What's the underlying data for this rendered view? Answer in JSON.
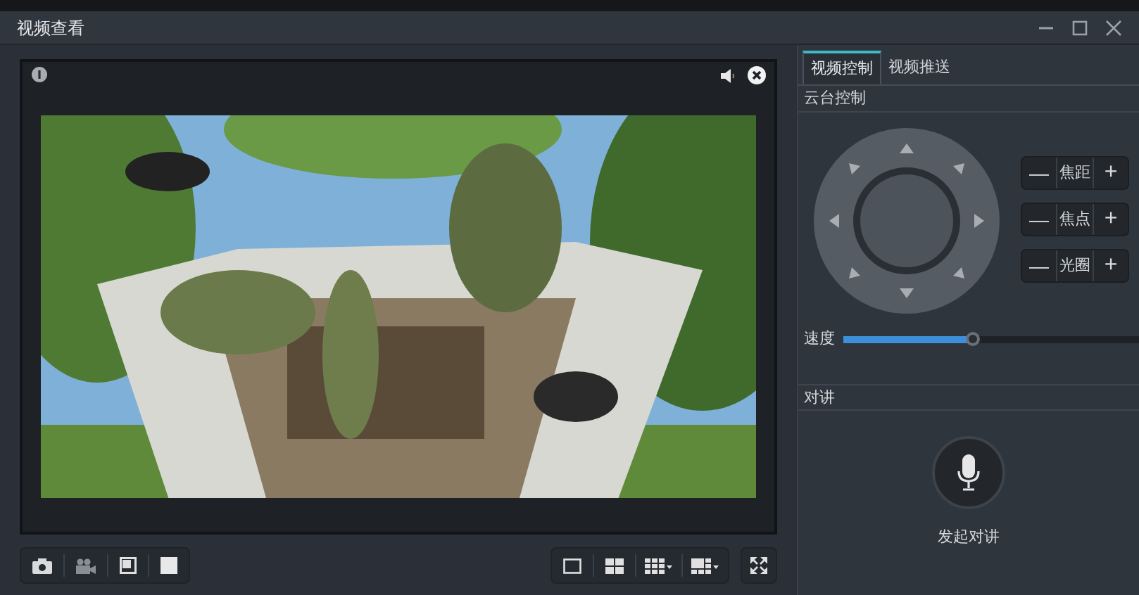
{
  "window": {
    "title": "视频查看"
  },
  "tabs": [
    {
      "label": "视频控制",
      "selected": true
    },
    {
      "label": "视频推送",
      "selected": false
    }
  ],
  "ptz": {
    "title": "云台控制",
    "lens": [
      {
        "label": "焦距",
        "minus": "—",
        "plus": "+"
      },
      {
        "label": "焦点",
        "minus": "—",
        "plus": "+"
      },
      {
        "label": "光圈",
        "minus": "—",
        "plus": "+"
      }
    ],
    "speed": {
      "label": "速度",
      "level": 0.44
    }
  },
  "intercom": {
    "title": "对讲",
    "button": "发起对讲"
  }
}
